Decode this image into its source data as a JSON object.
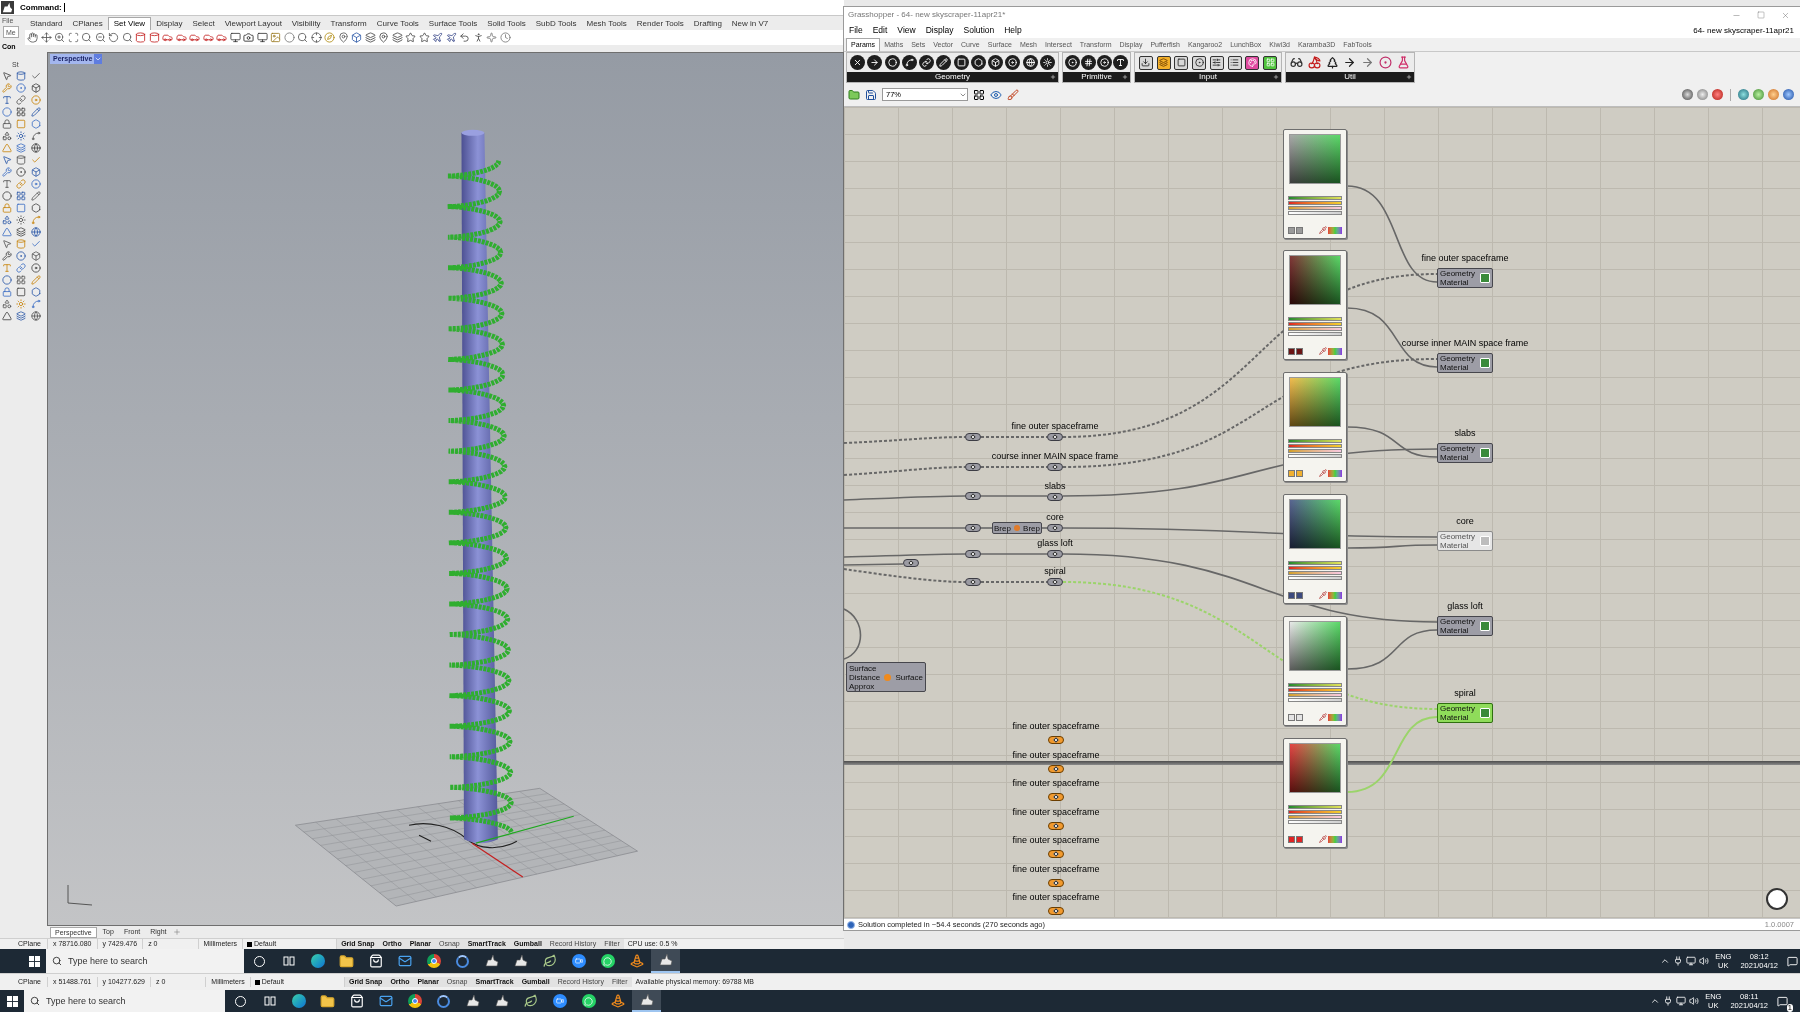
{
  "rhino": {
    "command_label": "Command:",
    "side_panel": [
      "File",
      "Me",
      "Con",
      "St"
    ],
    "toolbar_tabs": [
      {
        "label": "Standard",
        "selected": false
      },
      {
        "label": "CPlanes",
        "selected": false
      },
      {
        "label": "Set View",
        "selected": true
      },
      {
        "label": "Display",
        "selected": false
      },
      {
        "label": "Select",
        "selected": false
      },
      {
        "label": "Viewport Layout",
        "selected": false
      },
      {
        "label": "Visibility",
        "selected": false
      },
      {
        "label": "Transform",
        "selected": false
      },
      {
        "label": "Curve Tools",
        "selected": false
      },
      {
        "label": "Surface Tools",
        "selected": false
      },
      {
        "label": "Solid Tools",
        "selected": false
      },
      {
        "label": "SubD Tools",
        "selected": false
      },
      {
        "label": "Mesh Tools",
        "selected": false
      },
      {
        "label": "Render Tools",
        "selected": false
      },
      {
        "label": "Drafting",
        "selected": false
      },
      {
        "label": "New in V7",
        "selected": false
      }
    ],
    "viewport": {
      "title": "Perspective"
    },
    "viewport_tabs": [
      {
        "label": "Perspective",
        "selected": true
      },
      {
        "label": "Top",
        "selected": false
      },
      {
        "label": "Front",
        "selected": false
      },
      {
        "label": "Right",
        "selected": false
      }
    ],
    "status_bar": {
      "cplane": "CPlane",
      "x": "x 78716.080",
      "y": "y 7429.476",
      "z": "z 0",
      "units": "Millimeters",
      "layer": "Default",
      "toggles": [
        {
          "label": "Grid Snap",
          "on": true
        },
        {
          "label": "Ortho",
          "on": true
        },
        {
          "label": "Planar",
          "on": true
        },
        {
          "label": "Osnap",
          "on": false
        },
        {
          "label": "SmartTrack",
          "on": true
        },
        {
          "label": "Gumball",
          "on": true
        },
        {
          "label": "Record History",
          "on": false
        },
        {
          "label": "Filter",
          "on": false
        }
      ],
      "info": "CPU use: 0.5 %"
    }
  },
  "grasshopper": {
    "title": "Grasshopper - 64- new skyscraper-11apr21*",
    "menu": [
      "File",
      "Edit",
      "View",
      "Display",
      "Solution",
      "Help"
    ],
    "document_name": "64- new skyscraper-11apr21",
    "tabs": [
      {
        "label": "Params",
        "selected": true
      },
      {
        "label": "Maths",
        "selected": false
      },
      {
        "label": "Sets",
        "selected": false
      },
      {
        "label": "Vector",
        "selected": false
      },
      {
        "label": "Curve",
        "selected": false
      },
      {
        "label": "Surface",
        "selected": false
      },
      {
        "label": "Mesh",
        "selected": false
      },
      {
        "label": "Intersect",
        "selected": false
      },
      {
        "label": "Transform",
        "selected": false
      },
      {
        "label": "Display",
        "selected": false
      },
      {
        "label": "Pufferfish",
        "selected": false
      },
      {
        "label": "Kangaroo2",
        "selected": false
      },
      {
        "label": "LunchBox",
        "selected": false
      },
      {
        "label": "Kiwi3d",
        "selected": false
      },
      {
        "label": "Karamba3D",
        "selected": false
      },
      {
        "label": "FabTools",
        "selected": false
      }
    ],
    "ribbon_groups": [
      "Geometry",
      "Primitive",
      "Input",
      "Util"
    ],
    "zoom": "77%",
    "canvas": {
      "relays": [
        {
          "label": "fine outer spaceframe"
        },
        {
          "label": "course inner MAIN space frame"
        },
        {
          "label": "slabs"
        },
        {
          "label": "core"
        },
        {
          "label": "glass loft"
        },
        {
          "label": "spiral"
        }
      ],
      "brep_component": {
        "input": "Brep",
        "output": "Brep"
      },
      "surface_component": {
        "inputs": [
          "Surface",
          "Distance",
          "Approx"
        ],
        "output": "Surface"
      },
      "swatches": [
        {
          "color": "#9a9a9a"
        },
        {
          "color": "#6b1414"
        },
        {
          "color": "#f0b030"
        },
        {
          "color": "#3c4a7e"
        },
        {
          "color": "#e4e4e4"
        },
        {
          "color": "#e02424"
        }
      ],
      "previews": [
        {
          "label": "fine outer spaceframe",
          "inputs": [
            "Geometry",
            "Material"
          ],
          "selected": false,
          "enabled": true
        },
        {
          "label": "course inner MAIN space frame",
          "inputs": [
            "Geometry",
            "Material"
          ],
          "selected": false,
          "enabled": true
        },
        {
          "label": "slabs",
          "inputs": [
            "Geometry",
            "Material"
          ],
          "selected": false,
          "enabled": true
        },
        {
          "label": "core",
          "inputs": [
            "Geometry",
            "Material"
          ],
          "selected": false,
          "enabled": false
        },
        {
          "label": "glass loft",
          "inputs": [
            "Geometry",
            "Material"
          ],
          "selected": false,
          "enabled": true
        },
        {
          "label": "spiral",
          "inputs": [
            "Geometry",
            "Material"
          ],
          "selected": true,
          "enabled": true
        }
      ],
      "loose_relays": [
        {
          "label": "fine outer spaceframe"
        },
        {
          "label": "fine outer spaceframe"
        },
        {
          "label": "fine outer spaceframe"
        },
        {
          "label": "fine outer spaceframe"
        },
        {
          "label": "fine outer spaceframe"
        },
        {
          "label": "fine outer spaceframe"
        },
        {
          "label": "fine outer spaceframe"
        }
      ]
    },
    "status": "Solution completed in ~54.4 seconds (270 seconds ago)",
    "version": "1.0.0007"
  },
  "taskbar": {
    "search_placeholder": "Type here to search",
    "apps": [
      {
        "kind": "circle",
        "active": false
      },
      {
        "kind": "taskview",
        "active": false
      },
      {
        "kind": "wave",
        "active": false
      },
      {
        "kind": "folder",
        "active": false
      },
      {
        "kind": "bag",
        "active": false
      },
      {
        "kind": "mail",
        "active": false
      },
      {
        "kind": "tricolor",
        "active": false
      },
      {
        "kind": "swirl",
        "active": false
      },
      {
        "kind": "horn",
        "active": false
      },
      {
        "kind": "horn",
        "active": false
      },
      {
        "kind": "leaf",
        "active": false
      },
      {
        "kind": "video",
        "active": false
      },
      {
        "kind": "chat",
        "active": false
      },
      {
        "kind": "cone",
        "active": false
      },
      {
        "kind": "horn",
        "active": true
      }
    ],
    "tray": {
      "language": "ENG",
      "region": "UK",
      "time": "08:12",
      "date": "2021/04/12"
    }
  },
  "lower_capture": {
    "status_bar": {
      "cplane": "CPlane",
      "x": "x 51488.761",
      "y": "y 104277.629",
      "z": "z 0",
      "units": "Millimeters",
      "layer": "Default",
      "toggles": [
        {
          "label": "Grid Snap",
          "on": true
        },
        {
          "label": "Ortho",
          "on": true
        },
        {
          "label": "Planar",
          "on": true
        },
        {
          "label": "Osnap",
          "on": false
        },
        {
          "label": "SmartTrack",
          "on": true
        },
        {
          "label": "Gumball",
          "on": true
        },
        {
          "label": "Record History",
          "on": false
        },
        {
          "label": "Filter",
          "on": false
        }
      ],
      "info": "Available physical memory: 69788 MB"
    },
    "taskbar": {
      "search_placeholder": "Type here to search",
      "apps": [
        {
          "kind": "circle",
          "active": false
        },
        {
          "kind": "taskview",
          "active": false
        },
        {
          "kind": "wave",
          "active": false
        },
        {
          "kind": "folder",
          "active": false
        },
        {
          "kind": "bag",
          "active": false
        },
        {
          "kind": "mail",
          "active": false
        },
        {
          "kind": "tricolor",
          "active": false
        },
        {
          "kind": "swirl",
          "active": false
        },
        {
          "kind": "horn",
          "active": false
        },
        {
          "kind": "horn",
          "active": false
        },
        {
          "kind": "leaf",
          "active": false
        },
        {
          "kind": "video",
          "active": false
        },
        {
          "kind": "chat",
          "active": false
        },
        {
          "kind": "cone",
          "active": false
        },
        {
          "kind": "horn",
          "active": true
        }
      ],
      "tray": {
        "language": "ENG",
        "region": "UK",
        "time": "08:11",
        "date": "2021/04/12",
        "notifications": "1"
      }
    }
  }
}
